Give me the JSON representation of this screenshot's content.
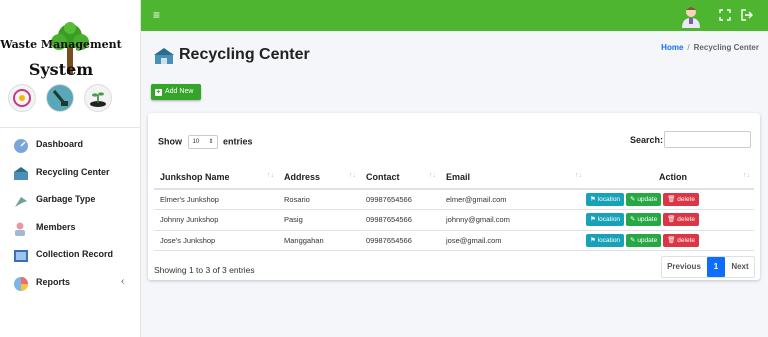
{
  "brand": {
    "line1": "Waste Management",
    "line2": "System"
  },
  "sidebar": {
    "items": [
      {
        "label": "Dashboard",
        "icon": "dashboard-icon"
      },
      {
        "label": "Recycling Center",
        "icon": "recycling-center-icon"
      },
      {
        "label": "Garbage Type",
        "icon": "garbage-type-icon"
      },
      {
        "label": "Members",
        "icon": "members-icon"
      },
      {
        "label": "Collection Record",
        "icon": "collection-record-icon"
      },
      {
        "label": "Reports",
        "icon": "reports-icon",
        "arrow": "‹"
      }
    ]
  },
  "topbar": {
    "menu_glyph": "≡",
    "color": "#4db52f"
  },
  "page": {
    "title": "Recycling Center"
  },
  "breadcrumb": {
    "home": "Home",
    "separator": "/",
    "current": "Recycling Center"
  },
  "add_button": {
    "label": "Add New",
    "glyph": "+"
  },
  "table_controls": {
    "show_label": "Show",
    "entries_value": "10",
    "entries_label": "entries",
    "search_label": "Search:",
    "search_value": ""
  },
  "table": {
    "headers": [
      "Junkshop Name",
      "Address",
      "Contact",
      "Email",
      "Action"
    ],
    "rows": [
      {
        "name": "Elmer's Junkshop",
        "address": "Rosario",
        "contact": "09987654566",
        "email": "elmer@gmail.com"
      },
      {
        "name": "Johnny Junkshop",
        "address": "Pasig",
        "contact": "09987654566",
        "email": "johnny@gmail.com"
      },
      {
        "name": "Jose's Junkshop",
        "address": "Manggahan",
        "contact": "09987654566",
        "email": "jose@gmail.com"
      }
    ],
    "action_labels": {
      "location": "location",
      "update": "update",
      "delete": "delete"
    }
  },
  "footer": {
    "showing": "Showing 1 to 3 of 3 entries",
    "previous": "Previous",
    "page": "1",
    "next": "Next"
  },
  "colors": {
    "accent": "#4db52f",
    "primary": "#0d6efd",
    "info": "#17a2b8",
    "success": "#28a745",
    "danger": "#dc3545"
  }
}
